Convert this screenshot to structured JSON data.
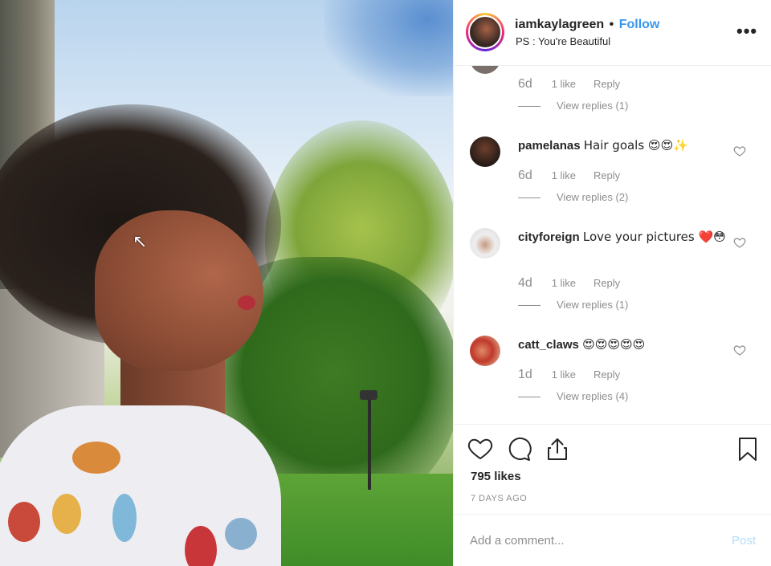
{
  "header": {
    "username": "iamkaylagreen",
    "separator": "•",
    "follow_label": "Follow",
    "subtitle": "PS : You're Beautiful"
  },
  "top_comment_meta": {
    "time": "6d",
    "likes": "1 like",
    "reply": "Reply",
    "view_replies": "View replies (1)"
  },
  "comments": [
    {
      "username": "pamelanas",
      "text": "Hair goals 😍😍✨",
      "time": "6d",
      "likes": "1 like",
      "reply": "Reply",
      "view_replies": "View replies (2)"
    },
    {
      "username": "cityforeign",
      "text": "Love your pictures ❤️😳",
      "time": "4d",
      "likes": "1 like",
      "reply": "Reply",
      "view_replies": "View replies (1)"
    },
    {
      "username": "catt_claws",
      "text": "😍😍😍😍😍",
      "time": "1d",
      "likes": "1 like",
      "reply": "Reply",
      "view_replies": "View replies (4)"
    }
  ],
  "post": {
    "likes": "795 likes",
    "time_ago": "7 DAYS AGO"
  },
  "add_comment": {
    "placeholder": "Add a comment...",
    "post_label": "Post"
  },
  "icons": {
    "like": "heart-icon",
    "comment": "comment-bubble-icon",
    "share": "share-icon",
    "save": "bookmark-icon",
    "more": "more-options-icon"
  },
  "colors": {
    "link": "#3897f0",
    "muted": "#8e8e8e",
    "post_disabled": "#b2dffc",
    "text": "#262626"
  }
}
